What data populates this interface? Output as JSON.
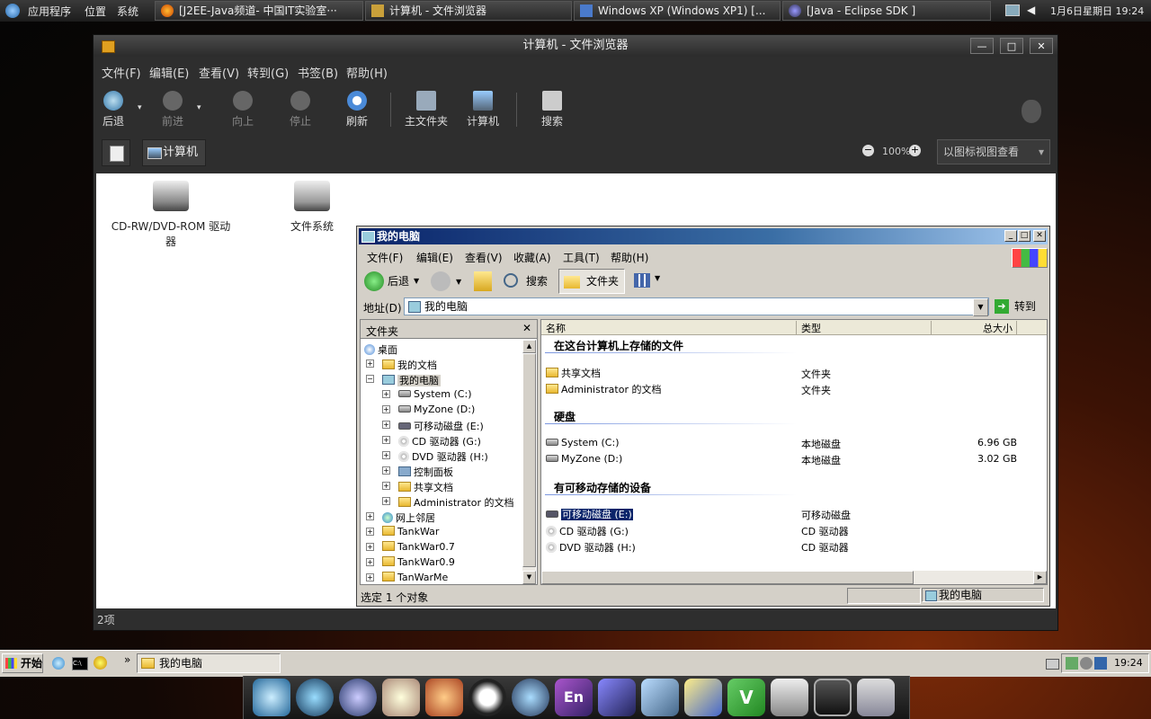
{
  "top_panel": {
    "menus": [
      "应用程序",
      "位置",
      "系统"
    ],
    "tasks": [
      {
        "label": "[J2EE-Java频道- 中国IT实验室···"
      },
      {
        "label": "计算机 - 文件浏览器"
      },
      {
        "label": "Windows XP (Windows XP1) [..."
      },
      {
        "label": "[Java - Eclipse SDK ]"
      }
    ],
    "clock": "1月6日星期日 19:24"
  },
  "nautilus": {
    "title": "计算机 - 文件浏览器",
    "menu": [
      "文件(F)",
      "编辑(E)",
      "查看(V)",
      "转到(G)",
      "书签(B)",
      "帮助(H)"
    ],
    "toolbar": {
      "back": "后退",
      "forward": "前进",
      "up": "向上",
      "stop": "停止",
      "reload": "刷新",
      "home": "主文件夹",
      "computer": "计算机",
      "search": "搜索"
    },
    "location_button": "计算机",
    "zoom": "100%",
    "view_mode": "以图标视图查看",
    "items": [
      {
        "label": "CD-RW/DVD-ROM 驱动器"
      },
      {
        "label": "文件系统"
      }
    ],
    "status": "2项"
  },
  "xp_window": {
    "title": "我的电脑",
    "menu": [
      "文件(F)",
      "编辑(E)",
      "查看(V)",
      "收藏(A)",
      "工具(T)",
      "帮助(H)"
    ],
    "toolbar": {
      "back": "后退",
      "search": "搜索",
      "folders": "文件夹"
    },
    "address_label": "地址(D)",
    "address_value": "我的电脑",
    "go": "转到",
    "folder_pane_title": "文件夹",
    "tree": [
      {
        "label": "桌面",
        "level": 0
      },
      {
        "label": "我的文档",
        "level": 1
      },
      {
        "label": "我的电脑",
        "level": 1,
        "selected": true
      },
      {
        "label": "System (C:)",
        "level": 2
      },
      {
        "label": "MyZone (D:)",
        "level": 2
      },
      {
        "label": "可移动磁盘 (E:)",
        "level": 2
      },
      {
        "label": "CD 驱动器 (G:)",
        "level": 2
      },
      {
        "label": "DVD 驱动器 (H:)",
        "level": 2
      },
      {
        "label": "控制面板",
        "level": 2
      },
      {
        "label": "共享文档",
        "level": 2
      },
      {
        "label": "Administrator 的文档",
        "level": 2
      },
      {
        "label": "网上邻居",
        "level": 1
      },
      {
        "label": "TankWar",
        "level": 1
      },
      {
        "label": "TankWar0.7",
        "level": 1
      },
      {
        "label": "TankWar0.9",
        "level": 1
      },
      {
        "label": "TanWarMe",
        "level": 1
      }
    ],
    "columns": [
      "名称",
      "类型",
      "总大小"
    ],
    "groups": [
      {
        "title": "在这台计算机上存储的文件",
        "items": [
          {
            "name": "共享文档",
            "type": "文件夹",
            "size": ""
          },
          {
            "name": "Administrator 的文档",
            "type": "文件夹",
            "size": ""
          }
        ]
      },
      {
        "title": "硬盘",
        "items": [
          {
            "name": "System (C:)",
            "type": "本地磁盘",
            "size": "6.96 GB"
          },
          {
            "name": "MyZone (D:)",
            "type": "本地磁盘",
            "size": "3.02 GB"
          }
        ]
      },
      {
        "title": "有可移动存储的设备",
        "items": [
          {
            "name": "可移动磁盘 (E:)",
            "type": "可移动磁盘",
            "size": "",
            "selected": true
          },
          {
            "name": "CD 驱动器 (G:)",
            "type": "CD 驱动器",
            "size": ""
          },
          {
            "name": "DVD 驱动器 (H:)",
            "type": "CD 驱动器",
            "size": ""
          }
        ]
      }
    ],
    "status_left": "选定 1 个对象",
    "status_right": "我的电脑"
  },
  "xp_taskbar": {
    "start": "开始",
    "task": "我的电脑",
    "clock": "19:24"
  },
  "dock_icons": [
    "desktop-icon",
    "orb-icon",
    "thunderbird-icon",
    "rabbit-icon",
    "colosseum-icon",
    "qq-penguin-icon",
    "wolf-icon",
    "en-dictionary-icon",
    "game-cube-icon",
    "magic-wand-icon",
    "ruler-pen-icon",
    "vim-icon",
    "printer-icon",
    "terminal-icon",
    "network-monitor-icon"
  ]
}
